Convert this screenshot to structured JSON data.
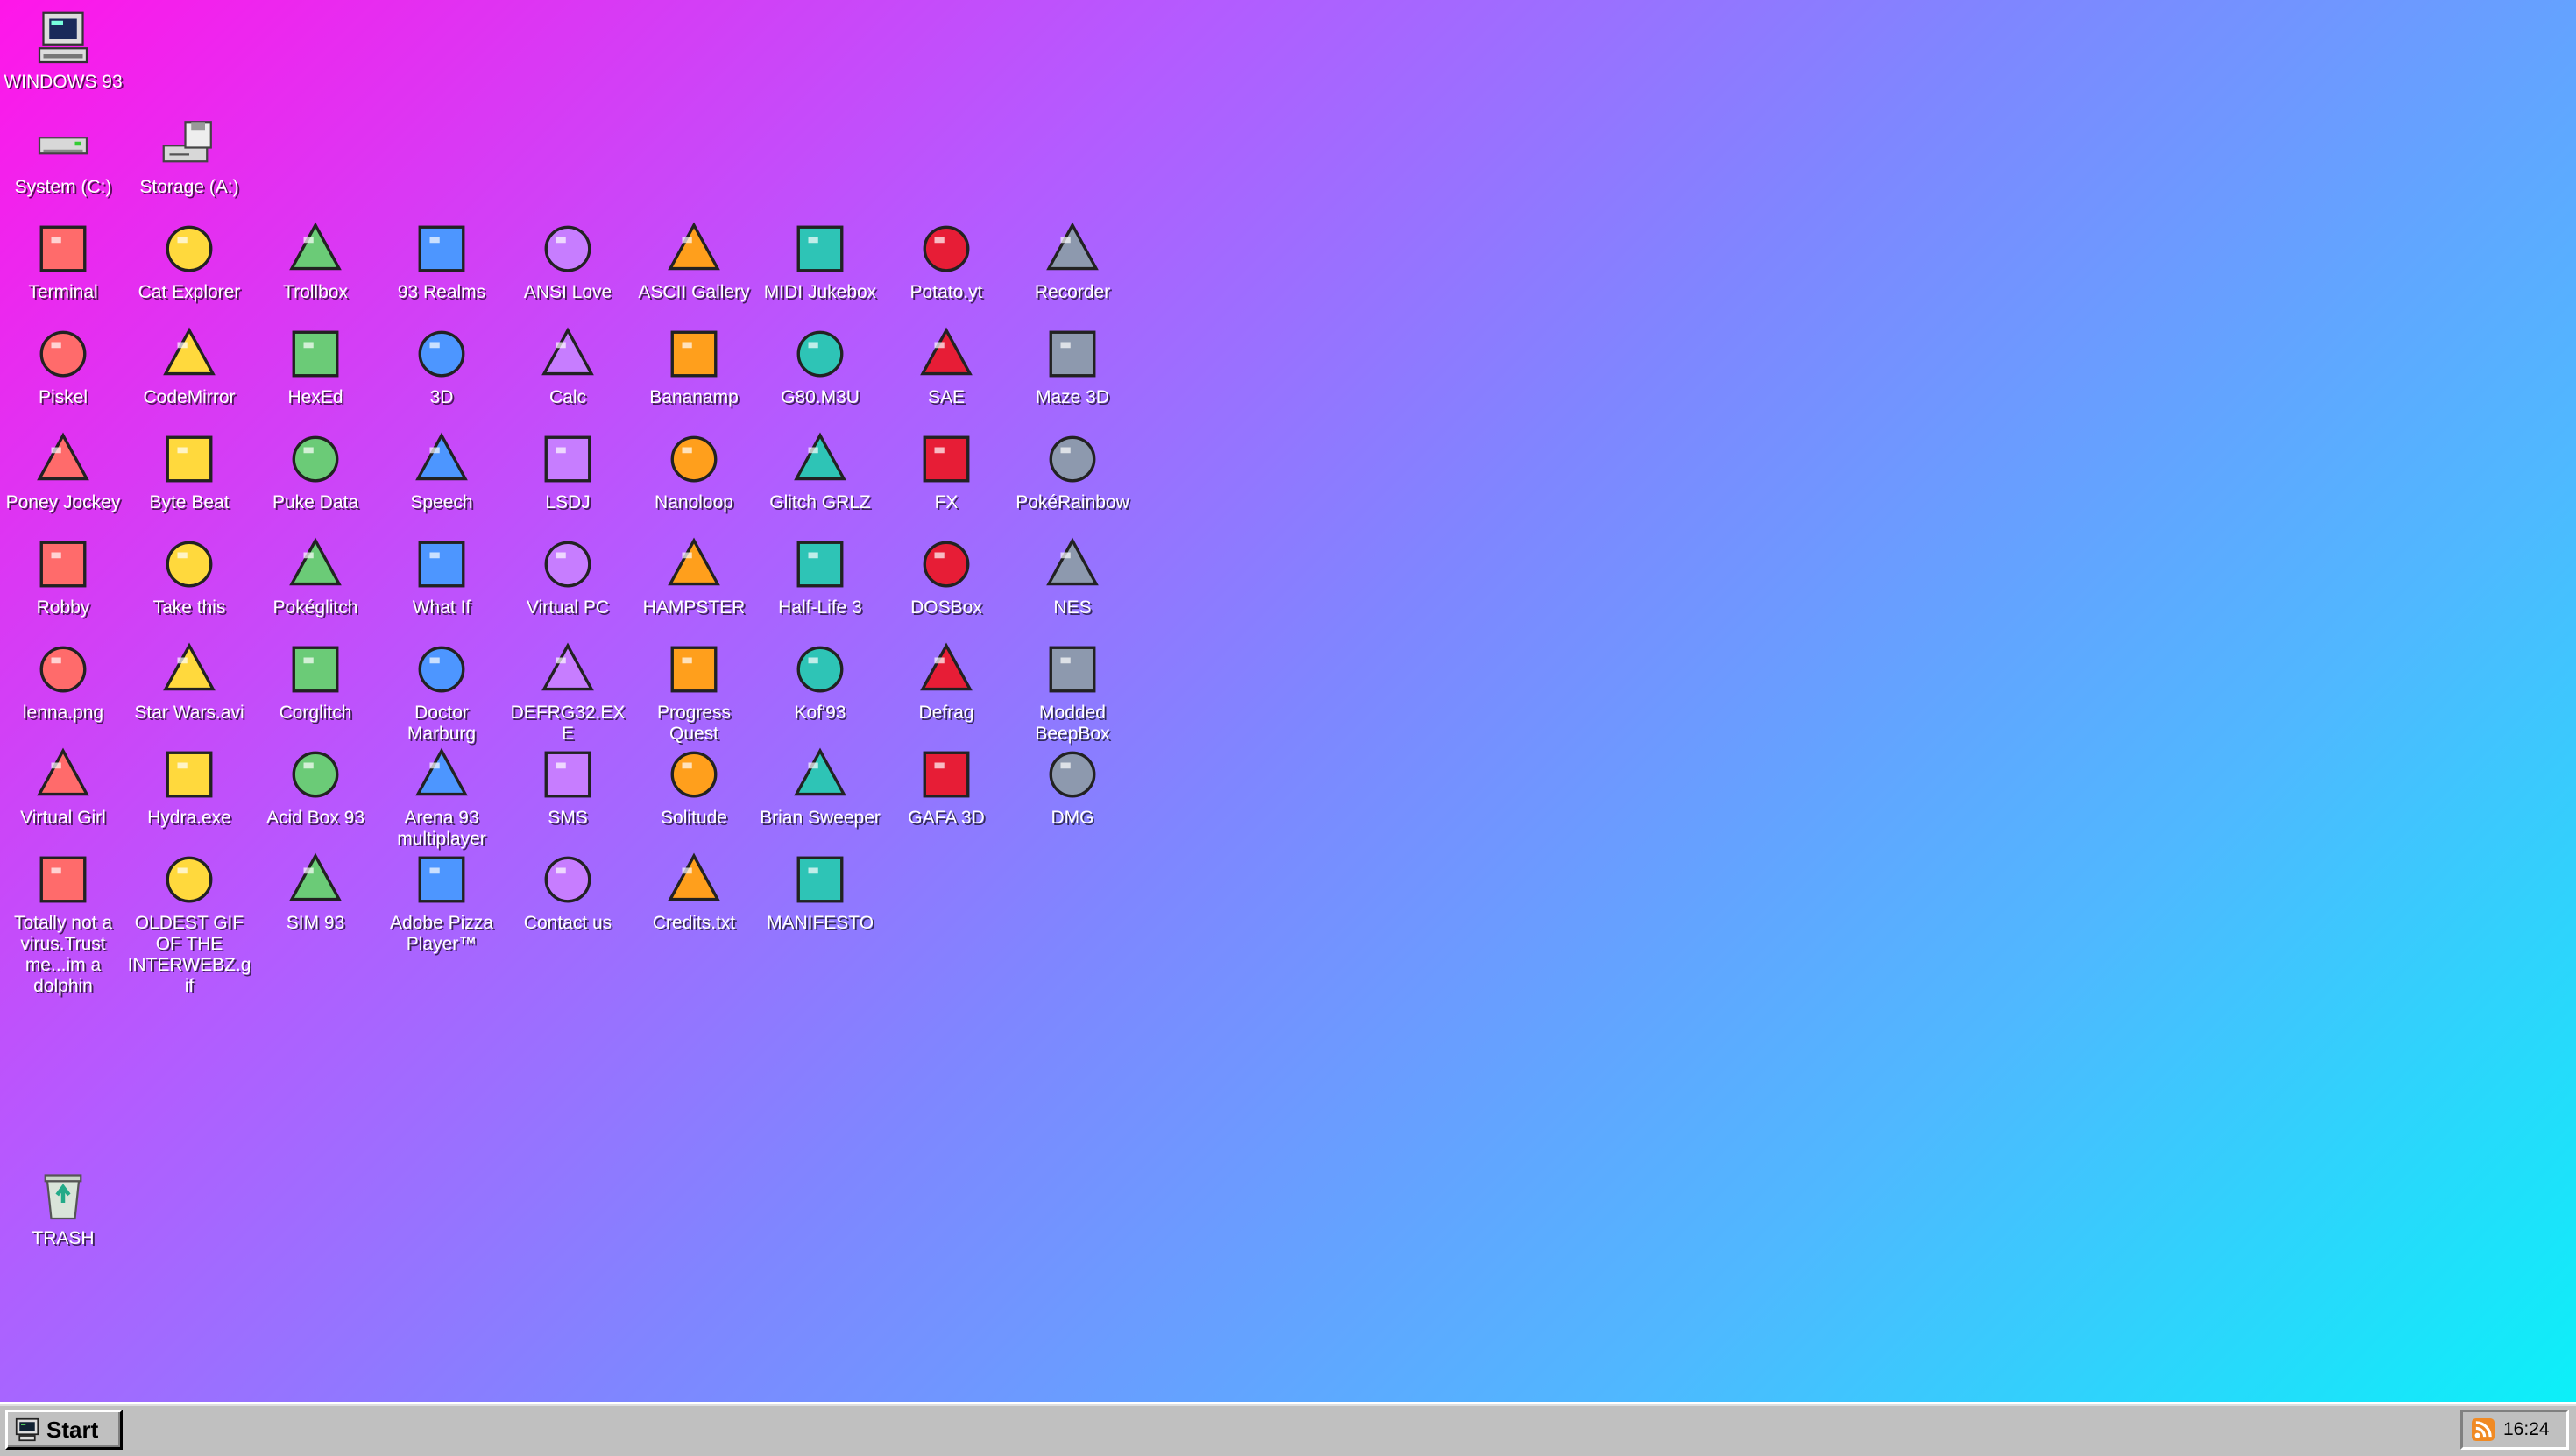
{
  "desktop": {
    "computer": {
      "label": "WINDOWS 93",
      "icon": "computer-icon"
    },
    "drives": [
      {
        "label": "System (C:)",
        "icon": "hard-drive-icon"
      },
      {
        "label": "Storage (A:)",
        "icon": "floppy-drive-icon"
      }
    ],
    "rows": [
      [
        "Terminal",
        "Cat Explorer",
        "Trollbox",
        "93 Realms",
        "ANSI Love",
        "ASCII Gallery",
        "MIDI Jukebox",
        "Potato.yt",
        "Recorder"
      ],
      [
        "Piskel",
        "CodeMirror",
        "HexEd",
        "3D",
        "Calc",
        "Bananamp",
        "G80.M3U",
        "SAE",
        "Maze 3D"
      ],
      [
        "Poney Jockey",
        "Byte Beat",
        "Puke Data",
        "Speech",
        "LSDJ",
        "Nanoloop",
        "Glitch GRLZ",
        "FX",
        "PokéRainbow"
      ],
      [
        "Robby",
        "Take this",
        "Pokéglitch",
        "What If",
        "Virtual PC",
        "HAMPSTER",
        "Half-Life 3",
        "DOSBox",
        "NES"
      ],
      [
        "lenna.png",
        "Star Wars.avi",
        "Corglitch",
        "Doctor Marburg",
        "DEFRG32.EXE",
        "Progress Quest",
        "Kof'93",
        "Defrag",
        "Modded BeepBox"
      ],
      [
        "Virtual Girl",
        "Hydra.exe",
        "Acid Box 93",
        "Arena 93 multiplayer",
        "SMS",
        "Solitude",
        "Brian Sweeper",
        "GAFA 3D",
        "DMG"
      ],
      [
        "Totally not a virus.Trust me...im a dolphin",
        "OLDEST GIF OF THE INTERWEBZ.gif",
        "SIM 93",
        "Adobe Pizza Player™",
        "Contact us",
        "Credits.txt",
        "MANIFESTO"
      ]
    ],
    "trash": {
      "label": "TRASH",
      "icon": "trash-icon"
    }
  },
  "taskbar": {
    "start_label": "Start",
    "clock": "16:24",
    "rss_icon": "rss-icon"
  },
  "colors": {
    "gradient": [
      "#ff16e9",
      "#b45bff",
      "#7f86ff",
      "#4fb8ff",
      "#08f3f8"
    ],
    "taskbar": "#c0c0c0"
  }
}
